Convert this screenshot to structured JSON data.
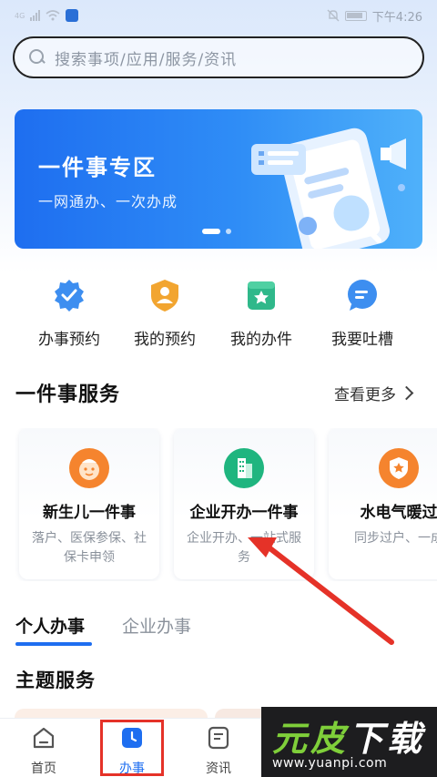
{
  "status_bar": {
    "network": "4G",
    "time": "下午4:26"
  },
  "search": {
    "placeholder": "搜索事项/应用/服务/资讯"
  },
  "banner": {
    "title": "一件事专区",
    "subtitle": "一网通办、一次办成"
  },
  "quick_actions": [
    {
      "label": "办事预约",
      "icon": "shield-check-icon",
      "color": "#3d8ef0"
    },
    {
      "label": "我的预约",
      "icon": "user-shield-icon",
      "color": "#f2a530"
    },
    {
      "label": "我的办件",
      "icon": "star-folder-icon",
      "color": "#2fb88a"
    },
    {
      "label": "我要吐槽",
      "icon": "chat-bubble-icon",
      "color": "#3d8ef0"
    }
  ],
  "services": {
    "title": "一件事服务",
    "see_more": "查看更多",
    "cards": [
      {
        "title": "新生儿一件事",
        "desc": "落户、医保参保、社保卡申领",
        "icon": "baby-face-icon",
        "color": "#f5842e"
      },
      {
        "title": "企业开办一件事",
        "desc": "企业开办、一站式服务",
        "icon": "building-icon",
        "color": "#1fb57f"
      },
      {
        "title": "水电气暖过",
        "desc": "同步过户、一成",
        "icon": "shield-star-icon",
        "color": "#f5842e"
      }
    ]
  },
  "tabs": {
    "personal": "个人办事",
    "company": "企业办事"
  },
  "theme": {
    "title": "主题服务"
  },
  "bottom_nav": {
    "items": [
      {
        "label": "首页",
        "icon": "home-icon"
      },
      {
        "label": "办事",
        "icon": "clock-icon"
      },
      {
        "label": "资讯",
        "icon": "news-icon"
      }
    ]
  },
  "watermark": {
    "text_a": "元皮",
    "text_b": "下载",
    "url": "www.yuanpi.com"
  },
  "colors": {
    "accent": "#1e6ef0",
    "highlight": "#e53228"
  }
}
